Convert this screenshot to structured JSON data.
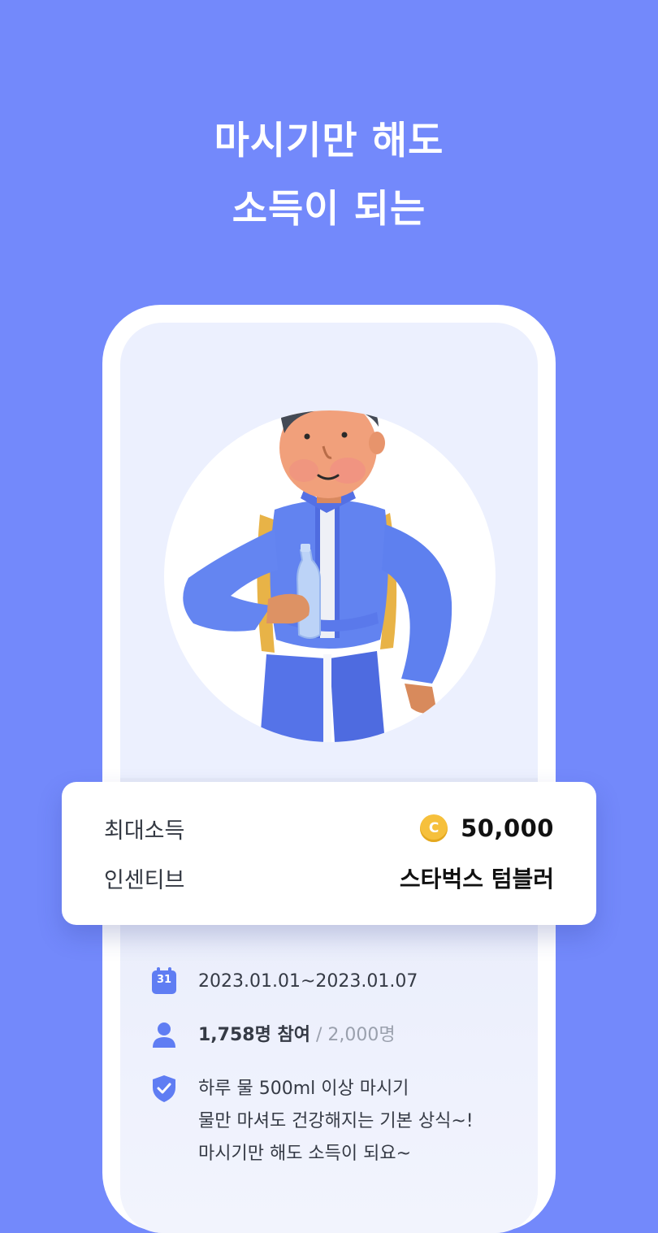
{
  "headline": {
    "line1": "마시기만 해도",
    "line2": "소득이 되는"
  },
  "hero": {
    "illustration": "3D character in blue jacket with yellow backpack holding a water bottle"
  },
  "info_card": {
    "max_income_label": "최대소득",
    "coin_symbol": "C",
    "max_income_value": "50,000",
    "incentive_label": "인센티브",
    "incentive_value": "스타벅스 텀블러"
  },
  "details": {
    "calendar_day": "31",
    "period": "2023.01.01~2023.01.07",
    "participants": "1,758명 참여",
    "capacity": " / 2,000명",
    "rule_line1": "하루 물 500ml 이상 마시기",
    "rule_line2": "물만 마셔도 건강해지는 기본 상식~!",
    "rule_line3": "마시기만 해도 소득이 되요~"
  },
  "colors": {
    "background": "#7389fb",
    "accent": "#5f7df3",
    "coin": "#f6c03c"
  }
}
